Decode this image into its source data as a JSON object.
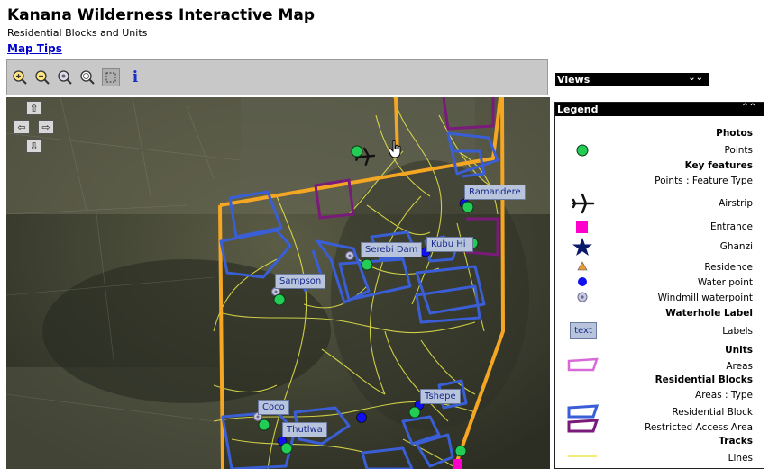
{
  "header": {
    "title": "Kanana Wilderness Interactive Map",
    "subtitle": "Residential Blocks and Units",
    "tips_link": "Map Tips"
  },
  "toolbar": {
    "tools": [
      {
        "name": "zoom-in-icon"
      },
      {
        "name": "zoom-out-icon"
      },
      {
        "name": "zoom-previous-icon"
      },
      {
        "name": "zoom-full-icon"
      },
      {
        "name": "zoom-box-icon"
      },
      {
        "name": "info-icon",
        "label": "i"
      }
    ]
  },
  "map": {
    "pan": {
      "up": "⇧",
      "left": "⇦",
      "right": "⇨",
      "down": "⇩"
    },
    "labels": [
      "Ramandere",
      "Serebi Dam",
      "Kubu Hi",
      "Sampson",
      "Coco",
      "Tshepe",
      "Thutlwa"
    ]
  },
  "views_panel": {
    "title": "Views",
    "chevron": "⌄⌄"
  },
  "legend": {
    "title": "Legend",
    "chevron": "⌃⌃",
    "items": [
      {
        "text": "Photos",
        "bold": true
      },
      {
        "text": "Points",
        "icon": "green-point-icon"
      },
      {
        "text": "Key features",
        "bold": true
      },
      {
        "text": "Points : Feature Type"
      },
      {
        "text": "Airstrip",
        "icon": "airplane-icon"
      },
      {
        "text": "Entrance",
        "icon": "magenta-square-icon"
      },
      {
        "text": "Ghanzi",
        "icon": "star-icon"
      },
      {
        "text": "Residence",
        "icon": "triangle-icon"
      },
      {
        "text": "Water point",
        "icon": "blue-dot-icon"
      },
      {
        "text": "Windmill waterpoint",
        "icon": "windmill-icon"
      },
      {
        "text": "Waterhole Label",
        "bold": true
      },
      {
        "text": "Labels",
        "icon": "label-box-icon",
        "icon_text": "text"
      },
      {
        "text": "Units",
        "bold": true
      },
      {
        "text": "Areas",
        "icon": "pink-area-icon"
      },
      {
        "text": "Residential Blocks",
        "bold": true
      },
      {
        "text": "Areas : Type"
      },
      {
        "text": "Residential Block",
        "icon": "blue-area-icon"
      },
      {
        "text": "Restricted Access Area",
        "icon": "purple-area-icon"
      },
      {
        "text": "Tracks",
        "bold": true
      },
      {
        "text": "Lines",
        "icon": "yellow-line-icon"
      }
    ]
  },
  "colors": {
    "boundary": "#f5a623",
    "block": "#3a5ed6",
    "restricted": "#7a1a7a",
    "track": "#e8e84a",
    "point": "#22cc55",
    "water": "#1010ee",
    "label_bg": "#b8c4dc"
  }
}
